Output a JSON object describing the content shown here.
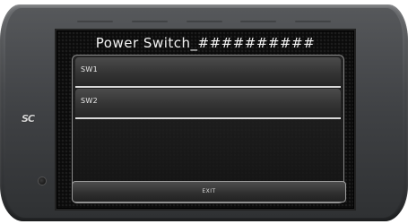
{
  "screen": {
    "title": "Power Switch_##########"
  },
  "switches": [
    {
      "label": "SW1"
    },
    {
      "label": "SW2"
    }
  ],
  "footer": {
    "exit_label": "EXIT"
  },
  "device": {
    "brand_mark": "SC",
    "icons": {
      "brand": "sc-logo-icon",
      "sensor": "ambient-sensor-icon"
    }
  }
}
